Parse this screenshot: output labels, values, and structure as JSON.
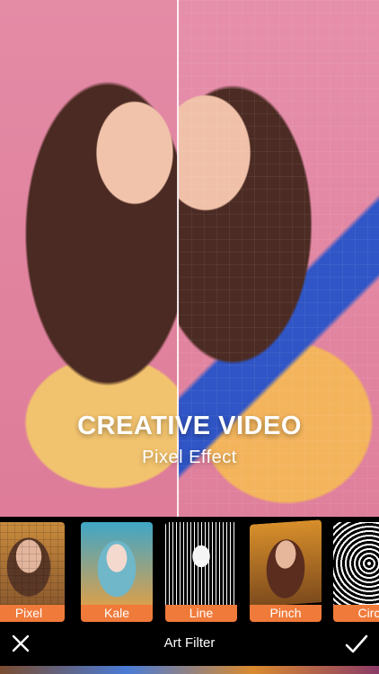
{
  "hero": {
    "title": "CREATIVE VIDEO",
    "subtitle": "Pixel Effect"
  },
  "filters": [
    {
      "label": "Pixel"
    },
    {
      "label": "Kale"
    },
    {
      "label": "Line"
    },
    {
      "label": "Pinch"
    },
    {
      "label": "Circ"
    }
  ],
  "toolbar": {
    "title": "Art Filter",
    "close_icon": "close-icon",
    "confirm_icon": "check-icon"
  },
  "colors": {
    "filter_label_bg": "#f07a3a",
    "background": "#000000",
    "hero_bg": "#df7f9b"
  }
}
